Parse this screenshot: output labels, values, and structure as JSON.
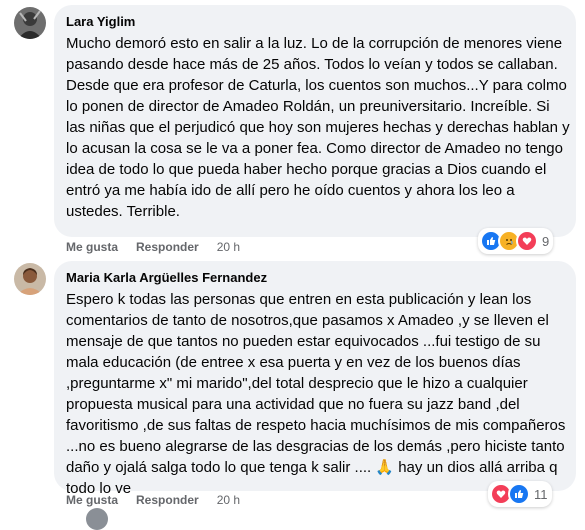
{
  "comments": [
    {
      "author": "Lara Yiglim",
      "text": "Mucho demoró esto en salir a la luz. Lo de la corrupción de menores viene pasando desde hace más de 25 años. Todos lo veían y todos se callaban. Desde que era profesor de Caturla, los cuentos son muchos...Y para colmo lo ponen de director de Amadeo Roldán, un preuniversitario. Increíble. Si las niñas que el perjudicó que hoy son mujeres hechas y derechas hablan y lo acusan la cosa se le va a poner fea. Como director de Amadeo no tengo idea de todo lo que pueda haber hecho porque gracias a Dios cuando el entró ya me había ido de allí pero he oído cuentos y ahora los leo a ustedes. Terrible.",
      "like_label": "Me gusta",
      "reply_label": "Responder",
      "time": "20 h",
      "reaction_icons": [
        "like-icon",
        "sad-icon",
        "love-icon"
      ],
      "reaction_count": "9"
    },
    {
      "author": "Maria Karla Argüelles Fernandez",
      "text": "Espero k todas las personas que entren en esta publicación y lean los comentarios de tanto de nosotros,que pasamos x Amadeo ,y se lleven el mensaje de que tantos no pueden estar equivocados ...fui testigo de su mala educación (de entree x esa puerta y en vez de los buenos días ,preguntarme x\" mi marido\",del total desprecio que le hizo a cualquier propuesta musical para una actividad que no fuera su jazz band ,del favoritismo ,de sus faltas de respeto hacia muchísimos de mis compañeros ...no es bueno alegrarse de las desgracias de los demás ,pero hiciste tanto daño y ojalá salga todo lo que tenga k salir .... 🙏 hay un dios allá arriba q todo lo ve",
      "like_label": "Me gusta",
      "reply_label": "Responder",
      "time": "20 h",
      "reaction_icons": [
        "love-icon",
        "like-icon"
      ],
      "reaction_count": "11"
    }
  ],
  "colors": {
    "bubble": "#f0f2f5",
    "meta": "#65676b",
    "like": "#1877f2",
    "love": "#f33e58",
    "sad": "#f7b125"
  }
}
